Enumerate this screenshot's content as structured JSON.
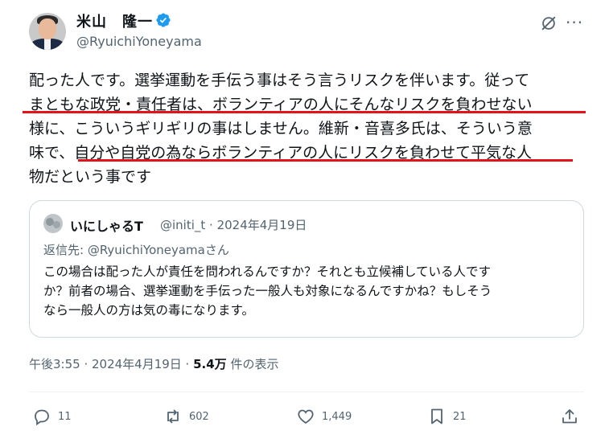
{
  "author": {
    "name": "米山　隆一",
    "handle": "@RyuichiYoneyama"
  },
  "post": {
    "lines": [
      "配った人です。選挙運動を手伝う事はそう言うリスクを伴います。従って",
      "まともな政党・責任者は、ボランティアの人にそんなリスクを負わせない",
      "様に、こういうギリギリの事はしません。維新・音喜多氏は、そういう意",
      "味で、自分や自党の為ならボランティアの人にリスクを負わせて平気な人",
      "物だという事です"
    ]
  },
  "quote": {
    "name": "いにしゃるT",
    "meta": "@initi_t · 2024年4月19日",
    "reply_to": "返信先: @RyuichiYoneyamaさん",
    "lines": [
      "この場合は配った人が責任を問われるんですか？それとも立候補している人です",
      "か？前者の場合、選挙運動を手伝った一般人も対象になるんですかね？もしそう",
      "なら一般人の方は気の毒になります。"
    ]
  },
  "timestamp": {
    "time": "午後3:55 · 2024年4月19日 · ",
    "views": "5.4万",
    "views_label": " 件の表示"
  },
  "actions": {
    "replies": "11",
    "reposts": "602",
    "likes": "1,449",
    "bookmarks": "21"
  },
  "colors": {
    "verified": "#1d9bf0",
    "highlight_underline": "#e3121b",
    "secondary_text": "#536471"
  }
}
